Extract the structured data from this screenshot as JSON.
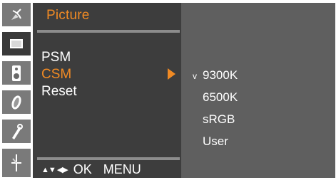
{
  "menu": {
    "title": "Picture",
    "items": [
      {
        "label": "PSM"
      },
      {
        "label": "CSM"
      },
      {
        "label": "Reset"
      }
    ]
  },
  "submenu": {
    "items": [
      {
        "label": "9300K",
        "checked": true,
        "check_mark": "v"
      },
      {
        "label": "6500K"
      },
      {
        "label": "sRGB"
      },
      {
        "label": "User"
      }
    ]
  },
  "footer": {
    "nav_symbols": "▲▼ ◀▶",
    "ok": "OK",
    "menu": "MENU"
  },
  "icons": [
    {
      "name": "satellite-dish-icon",
      "active": false
    },
    {
      "name": "picture-screen-icon",
      "active": true
    },
    {
      "name": "speaker-icon",
      "active": false
    },
    {
      "name": "clock-icon",
      "active": false
    },
    {
      "name": "setup-tool-icon",
      "active": false
    },
    {
      "name": "input-antenna-icon",
      "active": false
    }
  ],
  "colors": {
    "accent": "#f08a24",
    "panel_dark": "#3d3d3d",
    "panel_light": "#5f5f5f",
    "icon_tile": "#7a7a7a",
    "icon_tile_active": "#3a3a3a"
  }
}
